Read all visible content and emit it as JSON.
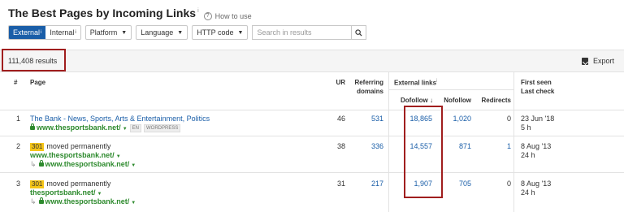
{
  "header": {
    "title": "The Best Pages by Incoming Links",
    "title_info": "i",
    "how_to_use": "How to use"
  },
  "toolbar": {
    "external_label": "External",
    "internal_label": "Internal",
    "info_mark": "i",
    "platform_label": "Platform",
    "language_label": "Language",
    "http_code_label": "HTTP code",
    "search_placeholder": "Search in results"
  },
  "results": {
    "count_text": "111,408 results",
    "export_label": "Export"
  },
  "table": {
    "headers": {
      "index": "#",
      "page": "Page",
      "ur": "UR",
      "referring_domains_1": "Referring",
      "referring_domains_2": "domains",
      "external_links": "External links",
      "external_links_info": "i",
      "dofollow": "Dofollow ↓",
      "nofollow": "Nofollow",
      "redirects": "Redirects",
      "first_seen": "First seen",
      "last_check": "Last check"
    },
    "rows": [
      {
        "index": "1",
        "page_title": "The Bank - News, Sports, Arts & Entertainment, Politics",
        "url": "www.thesportsbank.net/",
        "lang_tag": "EN",
        "platform_tag": "WORDPRESS",
        "ur": "46",
        "referring_domains": "531",
        "dofollow": "18,865",
        "nofollow": "1,020",
        "redirects": "0",
        "first_seen": "23 Jun '18",
        "last_check": "5 h"
      },
      {
        "index": "2",
        "status_code": "301",
        "status_text": "moved permanently",
        "url": "www.thesportsbank.net/",
        "redirect_url": "www.thesportsbank.net/",
        "ur": "38",
        "referring_domains": "336",
        "dofollow": "14,557",
        "nofollow": "871",
        "redirects": "1",
        "first_seen": "8 Aug '13",
        "last_check": "24 h"
      },
      {
        "index": "3",
        "status_code": "301",
        "status_text": "moved permanently",
        "url": "thesportsbank.net/",
        "redirect_url": "www.thesportsbank.net/",
        "ur": "31",
        "referring_domains": "217",
        "dofollow": "1,907",
        "nofollow": "705",
        "redirects": "0",
        "first_seen": "8 Aug '13",
        "last_check": "24 h"
      }
    ]
  },
  "colors": {
    "accent": "#1a5ea8",
    "url_green": "#2d8a2d",
    "highlight_red": "#a01e1e",
    "badge_yellow": "#f5c518"
  }
}
